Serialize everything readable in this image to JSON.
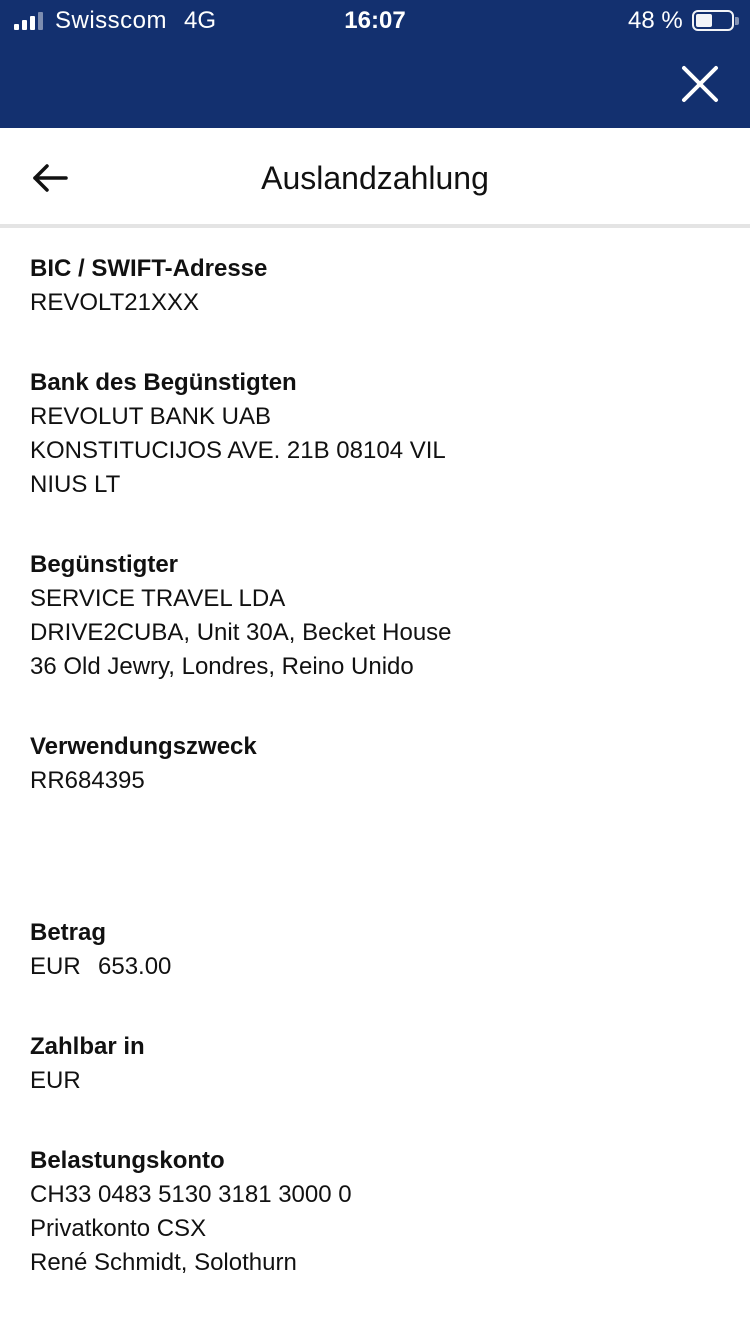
{
  "status_bar": {
    "carrier": "Swisscom",
    "network": "4G",
    "time": "16:07",
    "battery_percent": "48 %",
    "battery_level": 0.48,
    "icons": [
      "signal-icon",
      "battery-icon"
    ]
  },
  "header": {
    "title": "Auslandzahlung",
    "back_icon": "arrow-left-icon",
    "close_icon": "close-icon",
    "colors": {
      "bar": "#13306f",
      "divider": "#e4e4e4"
    }
  },
  "fields": {
    "bic": {
      "label": "BIC / SWIFT-Adresse",
      "lines": [
        "REVOLT21XXX"
      ]
    },
    "bank": {
      "label": "Bank des Begünstigten",
      "lines": [
        "REVOLUT BANK UAB",
        "KONSTITUCIJOS AVE. 21B 08104 VIL",
        "NIUS LT"
      ]
    },
    "beneficiary": {
      "label": "Begünstigter",
      "lines": [
        "SERVICE TRAVEL LDA",
        "DRIVE2CUBA, Unit 30A, Becket House",
        "36 Old Jewry, Londres, Reino Unido"
      ]
    },
    "reference": {
      "label": "Verwendungszweck",
      "lines": [
        "RR684395"
      ]
    },
    "amount": {
      "label": "Betrag",
      "currency": "EUR",
      "value": "653.00"
    },
    "payable_in": {
      "label": "Zahlbar in",
      "lines": [
        "EUR"
      ]
    },
    "debit_account": {
      "label": "Belastungskonto",
      "lines": [
        "CH33 0483 5130 3181 3000 0",
        "Privatkonto CSX",
        "René Schmidt, Solothurn"
      ]
    }
  }
}
